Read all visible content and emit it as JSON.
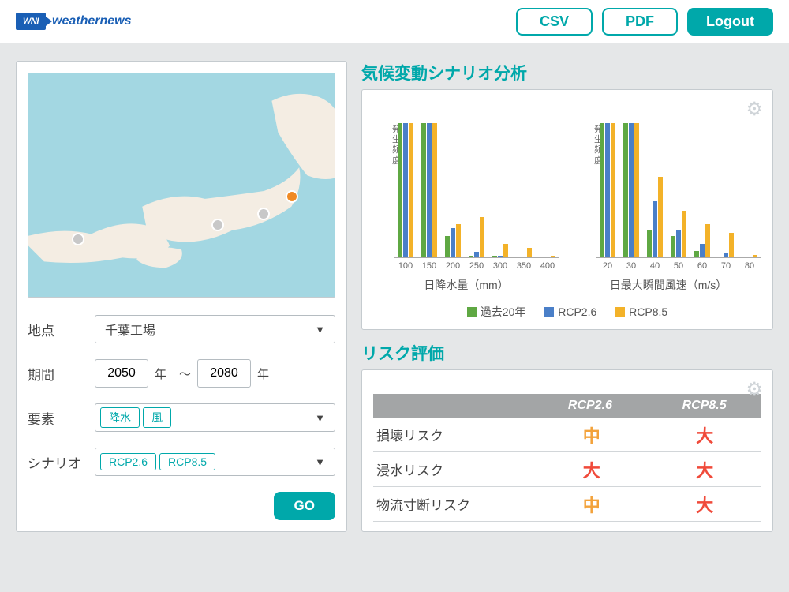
{
  "header": {
    "brand": "weathernews",
    "logo_abbrev": "WNI",
    "csv_label": "CSV",
    "pdf_label": "PDF",
    "logout_label": "Logout"
  },
  "form": {
    "location_label": "地点",
    "location_value": "千葉工場",
    "period_label": "期間",
    "year_from": "2050",
    "year_to": "2080",
    "year_suffix": "年",
    "range_sep": "〜",
    "element_label": "要素",
    "element_tags": [
      "降水",
      "風"
    ],
    "scenario_label": "シナリオ",
    "scenario_tags": [
      "RCP2.6",
      "RCP8.5"
    ],
    "go_label": "GO"
  },
  "analysis_title": "気候変動シナリオ分析",
  "risk_title": "リスク評価",
  "legend": {
    "past": "過去20年",
    "rcp26": "RCP2.6",
    "rcp85": "RCP8.5"
  },
  "risk_table": {
    "head_rcp26": "RCP2.6",
    "head_rcp85": "RCP8.5",
    "rows": [
      {
        "label": "損壊リスク",
        "rcp26": "中",
        "rcp85": "大"
      },
      {
        "label": "浸水リスク",
        "rcp26": "大",
        "rcp85": "大"
      },
      {
        "label": "物流寸断リスク",
        "rcp26": "中",
        "rcp85": "大"
      }
    ]
  },
  "chart_data": [
    {
      "type": "bar",
      "title": "",
      "xlabel": "日降水量（mm）",
      "ylabel": "発生頻度",
      "categories": [
        100,
        150,
        200,
        250,
        300,
        350,
        400
      ],
      "series": [
        {
          "name": "過去20年",
          "values": [
            100,
            100,
            16,
            1,
            1,
            0,
            0
          ]
        },
        {
          "name": "RCP2.6",
          "values": [
            100,
            100,
            22,
            4,
            1,
            0,
            0
          ]
        },
        {
          "name": "RCP8.5",
          "values": [
            100,
            100,
            25,
            30,
            10,
            7,
            1
          ]
        }
      ],
      "ylim": [
        0,
        100
      ]
    },
    {
      "type": "bar",
      "title": "",
      "xlabel": "日最大瞬間風速（m/s）",
      "ylabel": "発生頻度",
      "categories": [
        20,
        30,
        40,
        50,
        60,
        70,
        80
      ],
      "series": [
        {
          "name": "過去20年",
          "values": [
            100,
            100,
            20,
            16,
            5,
            0,
            0
          ]
        },
        {
          "name": "RCP2.6",
          "values": [
            100,
            100,
            42,
            20,
            10,
            3,
            0
          ]
        },
        {
          "name": "RCP8.5",
          "values": [
            100,
            100,
            60,
            35,
            25,
            18,
            2
          ]
        }
      ],
      "ylim": [
        0,
        100
      ]
    }
  ]
}
